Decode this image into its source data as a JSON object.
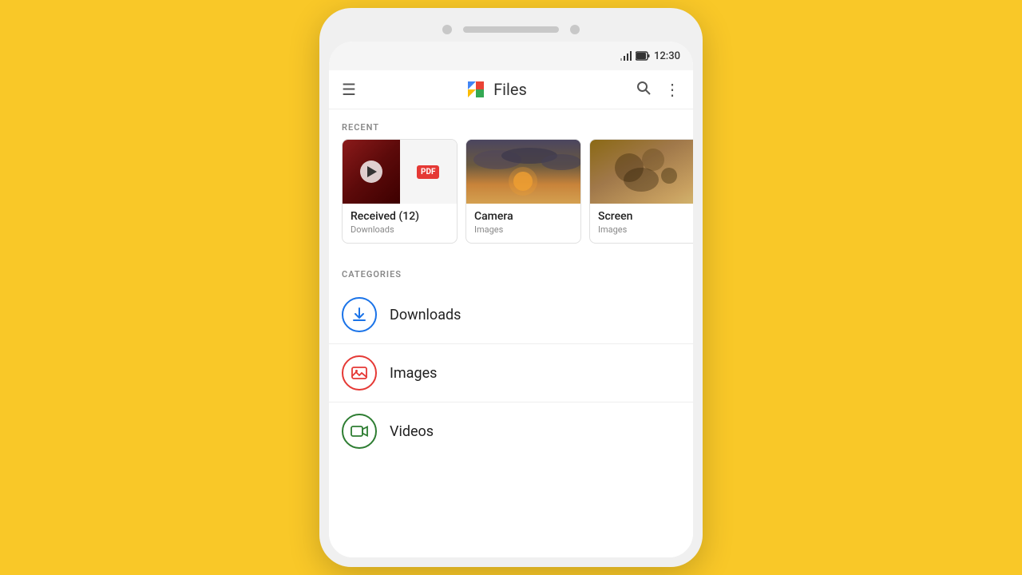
{
  "background_color": "#F9C828",
  "phone": {
    "status_bar": {
      "time": "12:30"
    },
    "app_bar": {
      "title": "Files",
      "hamburger_label": "☰",
      "search_label": "🔍",
      "more_label": "⋮"
    },
    "recent_section": {
      "label": "RECENT",
      "cards": [
        {
          "name": "Received (12)",
          "sub": "Downloads",
          "type": "received"
        },
        {
          "name": "Camera",
          "sub": "Images",
          "type": "camera"
        },
        {
          "name": "Screen",
          "sub": "Images",
          "type": "screen"
        }
      ]
    },
    "categories_section": {
      "label": "CATEGORIES",
      "items": [
        {
          "name": "Downloads",
          "icon_type": "downloads"
        },
        {
          "name": "Images",
          "icon_type": "images"
        },
        {
          "name": "Videos",
          "icon_type": "videos"
        }
      ]
    }
  }
}
